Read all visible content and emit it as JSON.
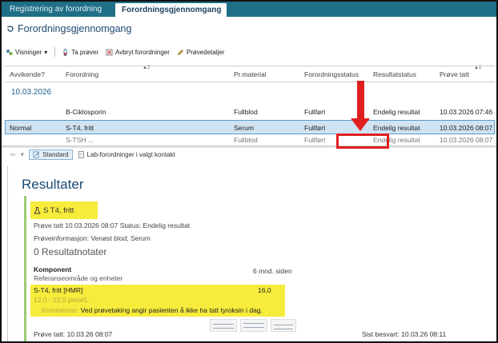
{
  "tabs": [
    {
      "label": "Registrering av forordning",
      "active": false
    },
    {
      "label": "Forordningsgjennomgang",
      "active": true
    }
  ],
  "page": {
    "title": "Forordningsgjennomgang"
  },
  "toolbar": {
    "views_label": "Visninger",
    "take_samples_label": "Ta prøver",
    "cancel_orders_label": "Avbryt forordninger",
    "sample_details_label": "Prøvedetaljer"
  },
  "grid": {
    "columns": [
      "Avvikende?",
      "Forordning",
      "Pr.material",
      "Forordningsstatus",
      "Resultatstatus",
      "Prøve tatt"
    ],
    "sort_marks": {
      "forordning": "▲2",
      "prove_tatt": "▲1"
    },
    "group_date": "10.03.2026",
    "rows": [
      {
        "abnormal": "",
        "order": "B-Ciklosporin",
        "material": "Fullblod",
        "order_status": "Fullført",
        "result_status": "Endelig resultat",
        "sample_taken": "10.03.2026 07:46",
        "selected": false
      },
      {
        "abnormal": "Normal",
        "order": "S-T4, fritt",
        "material": "Serum",
        "order_status": "Fullført",
        "result_status": "Endelig resultat",
        "sample_taken": "10.03.2026 08:07",
        "selected": true
      },
      {
        "abnormal": "",
        "order": "S-TSH ...",
        "material": "Fullblod",
        "order_status": "Fullført",
        "result_status": "Endelig resultat",
        "sample_taken": "10.03.2026 08:07",
        "selected": false
      }
    ]
  },
  "lower_toolbar": {
    "standard_label": "Standard",
    "lab_orders_label": "Lab-forordninger i valgt kontakt"
  },
  "results": {
    "title": "Resultater",
    "test_name": "S T4, fritt",
    "sample_info": "Prøve tatt 10.03.2026 08:07   Status: Endelig resultat",
    "sample_material": "Prøveinformasjon:  Venøst blod; Serum",
    "notes": "0  Resultatnotater",
    "component_label": "Komponent",
    "component_sub": "Referanseområde og enheter",
    "component_ago": "6 mnd. siden",
    "result_name": "S-T4, fritt [HMR]",
    "result_value": "16,0",
    "result_range": "12,0 - 22,0 pmol/L",
    "comment_label": "Kommentar:",
    "comment_text": "Ved prøvetaking angir pasienten å ikke ha tatt tyroksin i dag.",
    "footer_sample_taken": "Prøve tatt: 10.03.26 08:07",
    "footer_last_answered": "Sist besvart: 10.03.26 08:11"
  },
  "colors": {
    "header_teal": "#1f6f87",
    "title_blue": "#1c4970",
    "highlight_yellow": "#f7ec3c",
    "annotation_red": "#e02020",
    "selection_blue": "#cfe3f3"
  }
}
